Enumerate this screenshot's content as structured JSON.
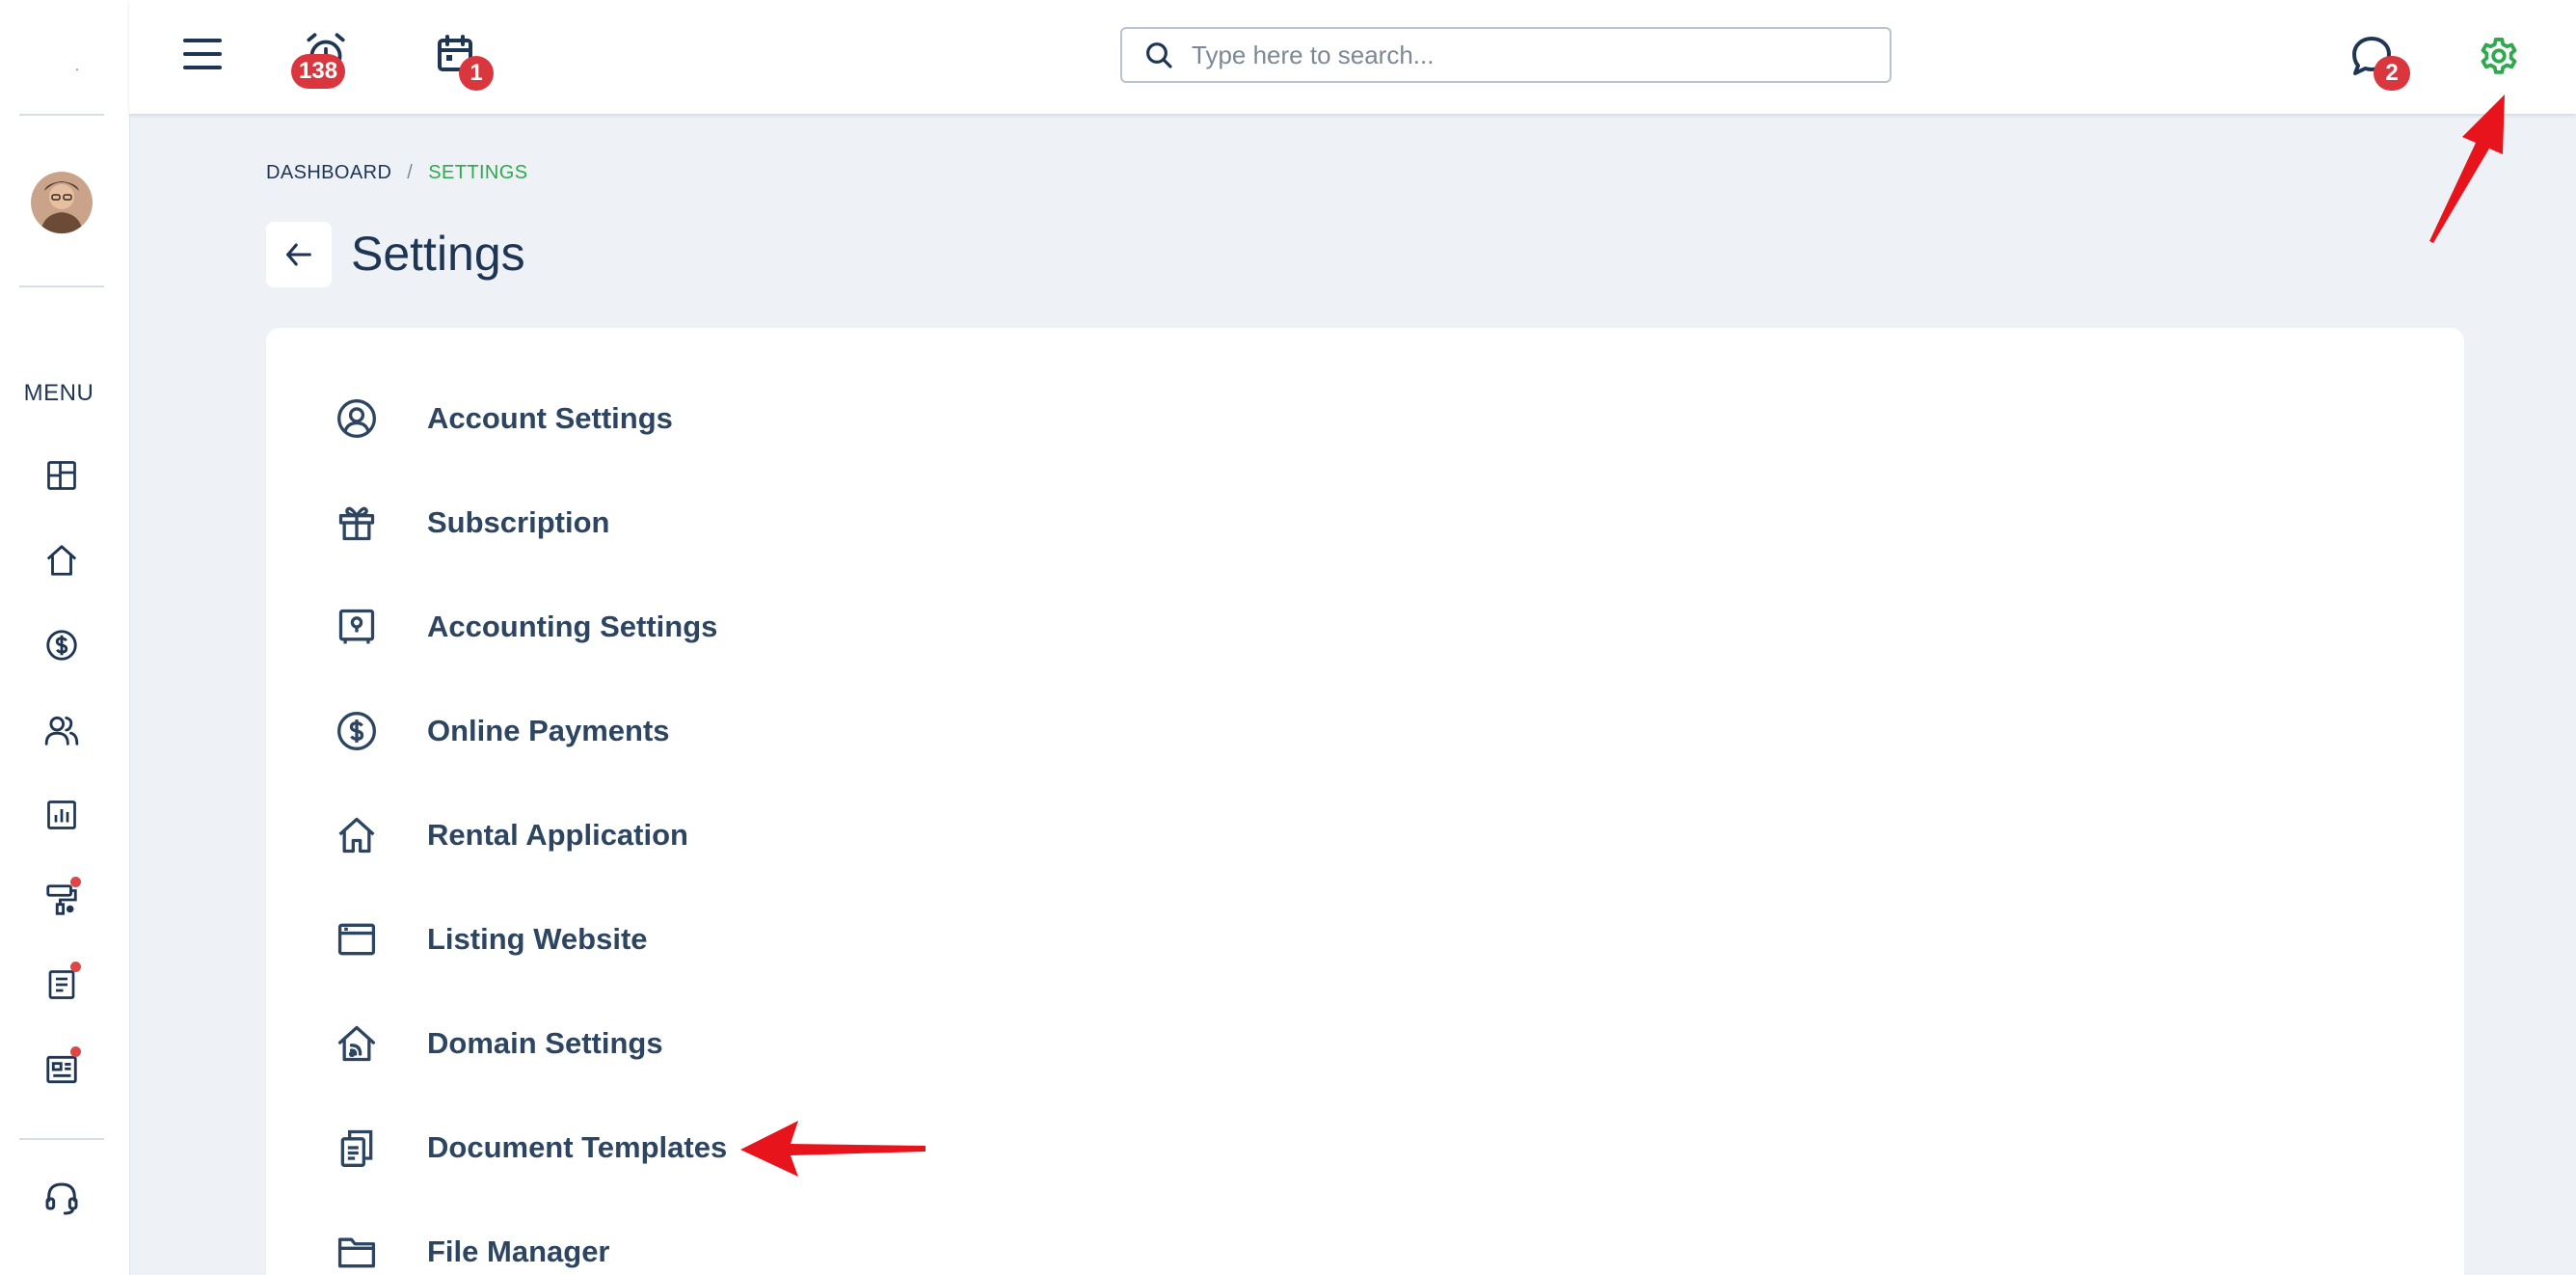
{
  "topbar": {
    "alarm_badge": "138",
    "calendar_badge": "1",
    "messages_badge": "2",
    "search_placeholder": "Type here to search..."
  },
  "sidebar": {
    "logo_text": ".",
    "menu_label": "MENU",
    "items": [
      {
        "icon": "dashboard-icon"
      },
      {
        "icon": "home-icon"
      },
      {
        "icon": "dollar-icon"
      },
      {
        "icon": "users-icon"
      },
      {
        "icon": "reports-icon"
      },
      {
        "icon": "paint-roller-icon",
        "has_notification": true
      },
      {
        "icon": "document-icon",
        "has_notification": true
      },
      {
        "icon": "news-icon",
        "has_notification": true
      },
      {
        "icon": "headset-icon"
      }
    ]
  },
  "breadcrumb": {
    "home": "DASHBOARD",
    "separator": "/",
    "current": "SETTINGS"
  },
  "page": {
    "title": "Settings"
  },
  "settings": [
    {
      "label": "Account Settings",
      "icon": "user-circle-icon"
    },
    {
      "label": "Subscription",
      "icon": "gift-icon"
    },
    {
      "label": "Accounting Settings",
      "icon": "safe-icon"
    },
    {
      "label": "Online Payments",
      "icon": "dollar-circle-icon"
    },
    {
      "label": "Rental Application",
      "icon": "house-icon"
    },
    {
      "label": "Listing Website",
      "icon": "browser-window-icon"
    },
    {
      "label": "Domain Settings",
      "icon": "house-signal-icon"
    },
    {
      "label": "Document Templates",
      "icon": "copy-documents-icon"
    },
    {
      "label": "File Manager",
      "icon": "folder-icon"
    }
  ],
  "colors": {
    "accent_green": "#2fa84f",
    "badge_red": "#d9363e",
    "annotation_red": "#e8141c",
    "text_navy": "#1e3553",
    "background": "#eef1f6"
  }
}
